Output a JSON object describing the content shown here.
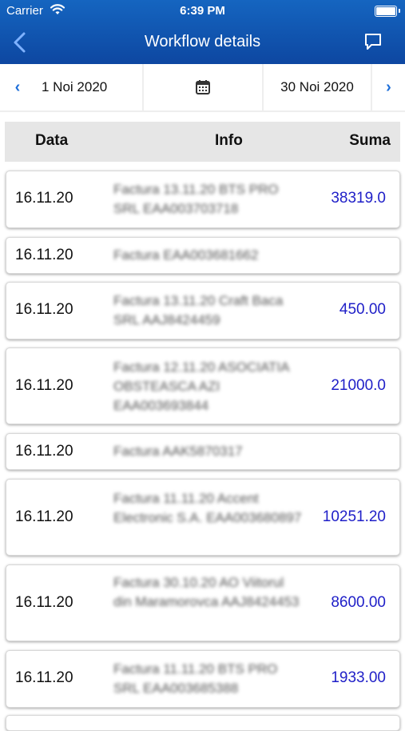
{
  "status": {
    "carrier": "Carrier",
    "time": "6:39 PM"
  },
  "nav": {
    "title": "Workflow details",
    "back_icon": "back-chevron-icon",
    "chat_icon": "chat-bubble-icon"
  },
  "date_range": {
    "start": "1 Noi 2020",
    "end": "30 Noi 2020"
  },
  "columns": {
    "data": "Data",
    "info": "Info",
    "suma": "Suma"
  },
  "rows": [
    {
      "date": "16.11.20",
      "info": "Factura 13.11.20 BTS PRO SRL EAA003703718",
      "sum": "38319.0"
    },
    {
      "date": "16.11.20",
      "info": "Factura   EAA003681662",
      "sum": ""
    },
    {
      "date": "16.11.20",
      "info": "Factura 13.11.20 Craft Baca SRL AAJ8424459",
      "sum": "450.00"
    },
    {
      "date": "16.11.20",
      "info": "Factura 12.11.20 ASOCIATIA OBSTEASCA AZI EAA003693844",
      "sum": "21000.0"
    },
    {
      "date": "16.11.20",
      "info": "Factura   AAK5870317",
      "sum": ""
    },
    {
      "date": "16.11.20",
      "info": "Factura 11.11.20 Accent Electronic S.A. EAA003680897",
      "sum": "10251.20"
    },
    {
      "date": "16.11.20",
      "info": "Factura 30.10.20 AO Viitorul din Maramorovca AAJ8424453",
      "sum": "8600.00"
    },
    {
      "date": "16.11.20",
      "info": "Factura 11.11.20 BTS PRO SRL EAA003685388",
      "sum": "1933.00"
    }
  ]
}
